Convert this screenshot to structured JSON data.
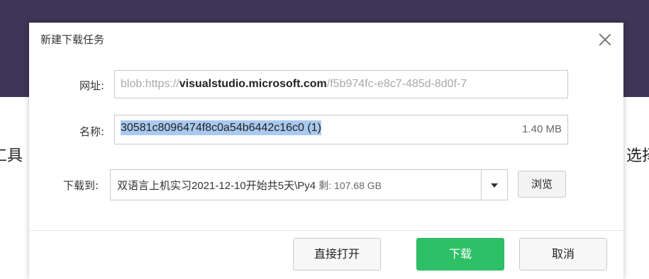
{
  "background": {
    "left_text": "工具",
    "right_text": "选择",
    "header_color": "#3f3556"
  },
  "dialog": {
    "title": "新建下载任务",
    "close_icon": "close-icon",
    "url": {
      "label": "网址:",
      "prefix": "blob:https://",
      "host": "visualstudio.microsoft.com",
      "suffix": "/f5b974fc-e8c7-485d-8d0f-7"
    },
    "name": {
      "label": "名称:",
      "value": "30581c8096474f8c0a54b6442c16c0 (1)",
      "size": "1.40 MB"
    },
    "save_to": {
      "label": "下载到:",
      "path": "双语言上机实习2021-12-10开始共5天\\Py4",
      "remaining": "剩: 107.68 GB",
      "dropdown_icon": "chevron-down-icon",
      "browse_label": "浏览"
    },
    "buttons": {
      "open_direct": "直接打开",
      "download": "下载",
      "cancel": "取消"
    },
    "accent_color": "#2ec066"
  }
}
